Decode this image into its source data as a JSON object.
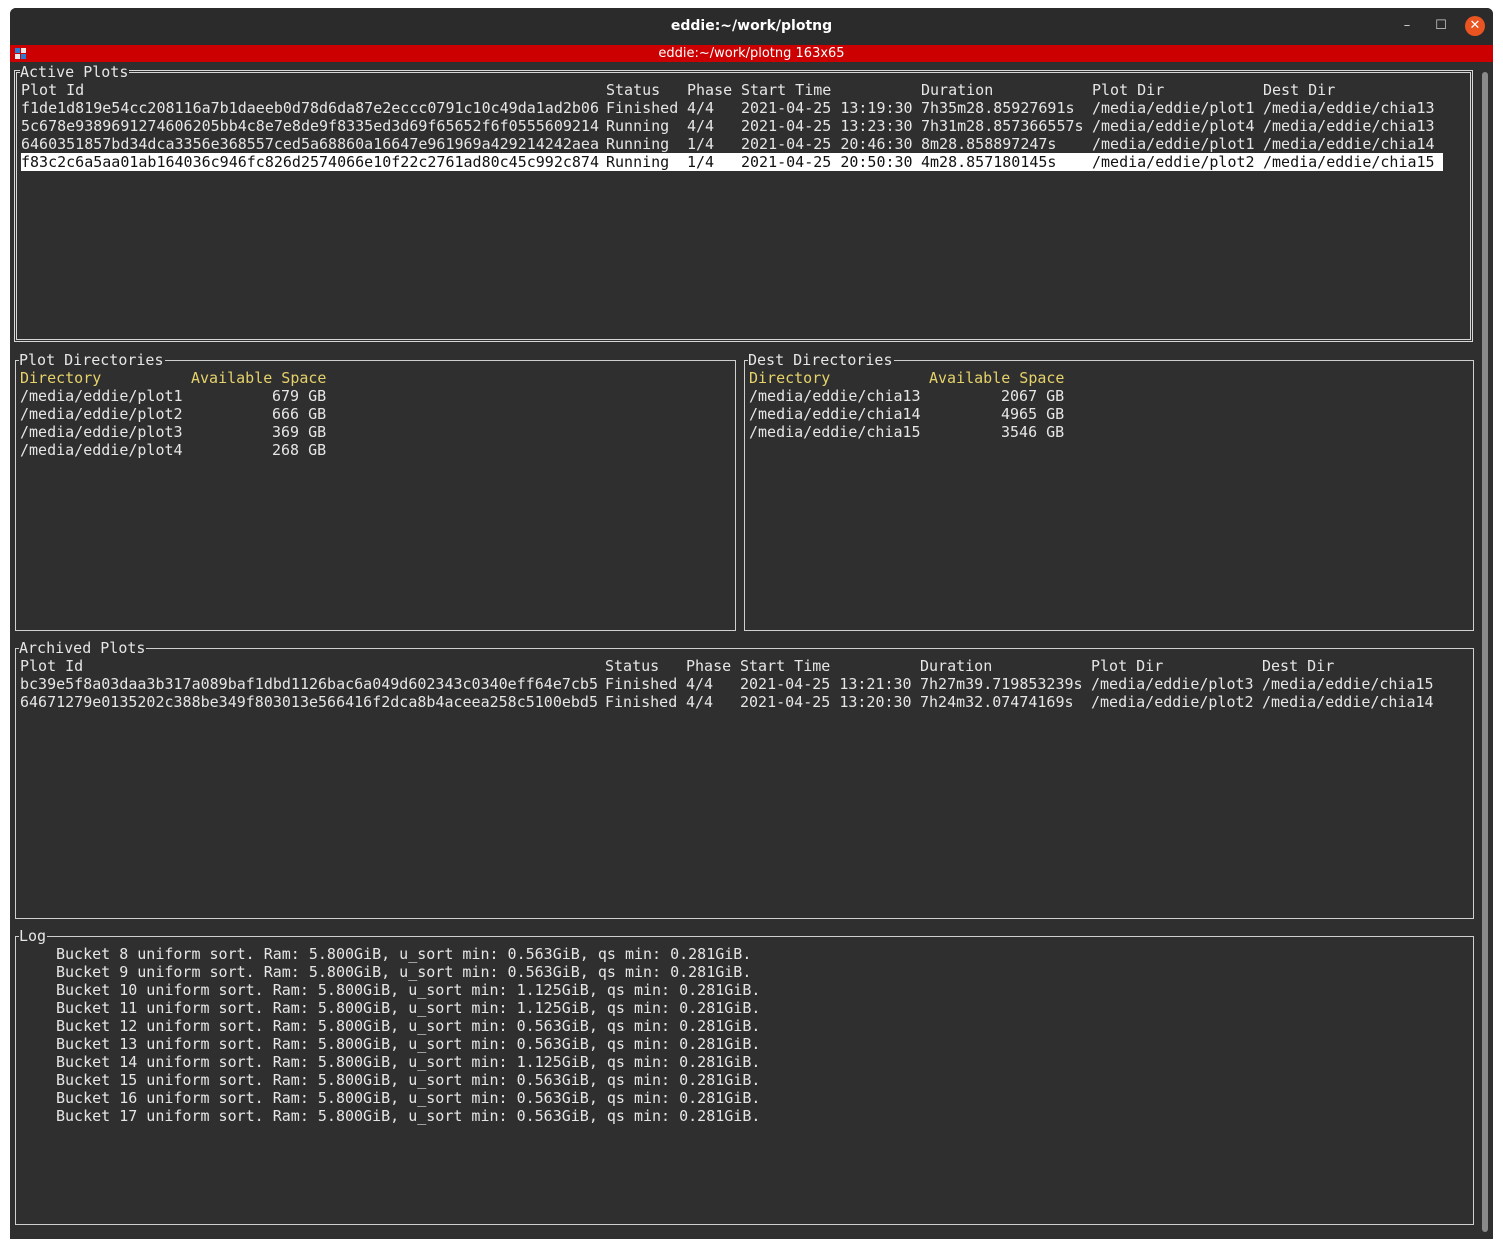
{
  "window": {
    "title": "eddie:~/work/plotng",
    "tab_title": "eddie:~/work/plotng 163x65",
    "minimize": "–",
    "maximize": "☐",
    "close": "✕"
  },
  "active": {
    "title": "Active Plots",
    "headers": [
      "Plot Id",
      "Status",
      "Phase",
      "Start Time",
      "Duration",
      "Plot Dir",
      "Dest Dir"
    ],
    "rows": [
      [
        "f1de1d819e54cc208116a7b1daeeb0d78d6da87e2eccc0791c10c49da1ad2b06",
        "Finished",
        "4/4",
        "2021-04-25 13:19:30",
        "7h35m28.85927691s",
        "/media/eddie/plot1",
        "/media/eddie/chia13"
      ],
      [
        "5c678e9389691274606205bb4c8e7e8de9f8335ed3d69f65652f6f0555609214",
        "Running",
        "4/4",
        "2021-04-25 13:23:30",
        "7h31m28.857366557s",
        "/media/eddie/plot4",
        "/media/eddie/chia13"
      ],
      [
        "6460351857bd34dca3356e368557ced5a68860a16647e961969a429214242aea",
        "Running",
        "1/4",
        "2021-04-25 20:46:30",
        "8m28.858897247s",
        "/media/eddie/plot1",
        "/media/eddie/chia14"
      ],
      [
        "f83c2c6a5aa01ab164036c946fc826d2574066e10f22c2761ad80c45c992c874",
        "Running",
        "1/4",
        "2021-04-25 20:50:30",
        "4m28.857180145s",
        "/media/eddie/plot2",
        "/media/eddie/chia15"
      ]
    ]
  },
  "plot_dirs": {
    "title": "Plot Directories",
    "headers": [
      "Directory",
      "Available Space"
    ],
    "rows": [
      [
        "/media/eddie/plot1",
        "679 GB"
      ],
      [
        "/media/eddie/plot2",
        "666 GB"
      ],
      [
        "/media/eddie/plot3",
        "369 GB"
      ],
      [
        "/media/eddie/plot4",
        "268 GB"
      ]
    ]
  },
  "dest_dirs": {
    "title": "Dest Directories",
    "headers": [
      "Directory",
      "Available Space"
    ],
    "rows": [
      [
        "/media/eddie/chia13",
        "2067 GB"
      ],
      [
        "/media/eddie/chia14",
        "4965 GB"
      ],
      [
        "/media/eddie/chia15",
        "3546 GB"
      ]
    ]
  },
  "archived": {
    "title": "Archived Plots",
    "headers": [
      "Plot Id",
      "Status",
      "Phase",
      "Start Time",
      "Duration",
      "Plot Dir",
      "Dest Dir"
    ],
    "rows": [
      [
        "bc39e5f8a03daa3b317a089baf1dbd1126bac6a049d602343c0340eff64e7cb5",
        "Finished",
        "4/4",
        "2021-04-25 13:21:30",
        "7h27m39.719853239s",
        "/media/eddie/plot3",
        "/media/eddie/chia15"
      ],
      [
        "64671279e0135202c388be349f803013e566416f2dca8b4aceea258c5100ebd5",
        "Finished",
        "4/4",
        "2021-04-25 13:20:30",
        "7h24m32.07474169s",
        "/media/eddie/plot2",
        "/media/eddie/chia14"
      ]
    ]
  },
  "log": {
    "title": "Log",
    "lines": [
      "Bucket 8 uniform sort. Ram: 5.800GiB, u_sort min: 0.563GiB, qs min: 0.281GiB.",
      "Bucket 9 uniform sort. Ram: 5.800GiB, u_sort min: 0.563GiB, qs min: 0.281GiB.",
      "Bucket 10 uniform sort. Ram: 5.800GiB, u_sort min: 1.125GiB, qs min: 0.281GiB.",
      "Bucket 11 uniform sort. Ram: 5.800GiB, u_sort min: 1.125GiB, qs min: 0.281GiB.",
      "Bucket 12 uniform sort. Ram: 5.800GiB, u_sort min: 0.563GiB, qs min: 0.281GiB.",
      "Bucket 13 uniform sort. Ram: 5.800GiB, u_sort min: 0.563GiB, qs min: 0.281GiB.",
      "Bucket 14 uniform sort. Ram: 5.800GiB, u_sort min: 1.125GiB, qs min: 0.281GiB.",
      "Bucket 15 uniform sort. Ram: 5.800GiB, u_sort min: 0.563GiB, qs min: 0.281GiB.",
      "Bucket 16 uniform sort. Ram: 5.800GiB, u_sort min: 0.563GiB, qs min: 0.281GiB.",
      "Bucket 17 uniform sort. Ram: 5.800GiB, u_sort min: 0.563GiB, qs min: 0.281GiB."
    ]
  }
}
